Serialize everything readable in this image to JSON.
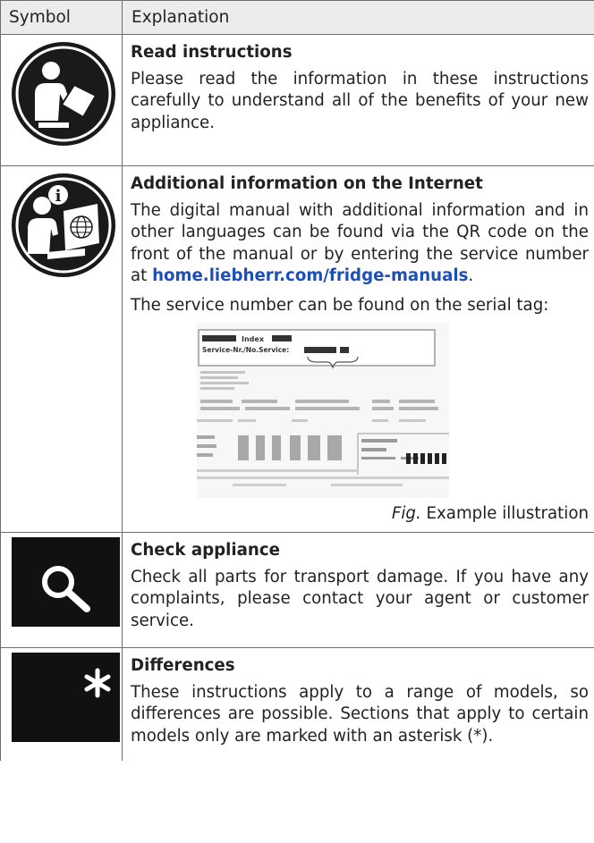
{
  "header": {
    "symbol": "Symbol",
    "explanation": "Explanation"
  },
  "rows": [
    {
      "icon": "read-instructions-icon",
      "title": "Read instructions",
      "text": "Please read the information in these instructions carefully to understand all of the benefits of your new appliance."
    },
    {
      "icon": "internet-info-icon",
      "title": "Additional information on the Internet",
      "text_before_link": "The digital manual with additional information and in other languages can be found via the QR code on the front of the manual or by entering the service number at ",
      "link": "home.liebherr.com/fridge-manuals",
      "text_after_link": ".",
      "text2": "The service number can be found on the serial tag:",
      "figure_label_line1": "Index",
      "figure_label_line2": "Service-Nr./No.Service:",
      "caption_fig": "Fig.",
      "caption_text": "Example illustration"
    },
    {
      "icon": "magnifier-icon",
      "title": "Check appliance",
      "text": "Check all parts for transport damage. If you have any complaints, please contact your agent or customer service."
    },
    {
      "icon": "asterisk-icon",
      "title": "Differences",
      "text": "These instructions apply to a range of models, so differences are possible. Sections that apply to certain models only are marked with an asterisk (*)."
    }
  ],
  "colors": {
    "link": "#1d50b5",
    "header_bg": "#ececec",
    "icon_bg": "#1a1a1a"
  }
}
